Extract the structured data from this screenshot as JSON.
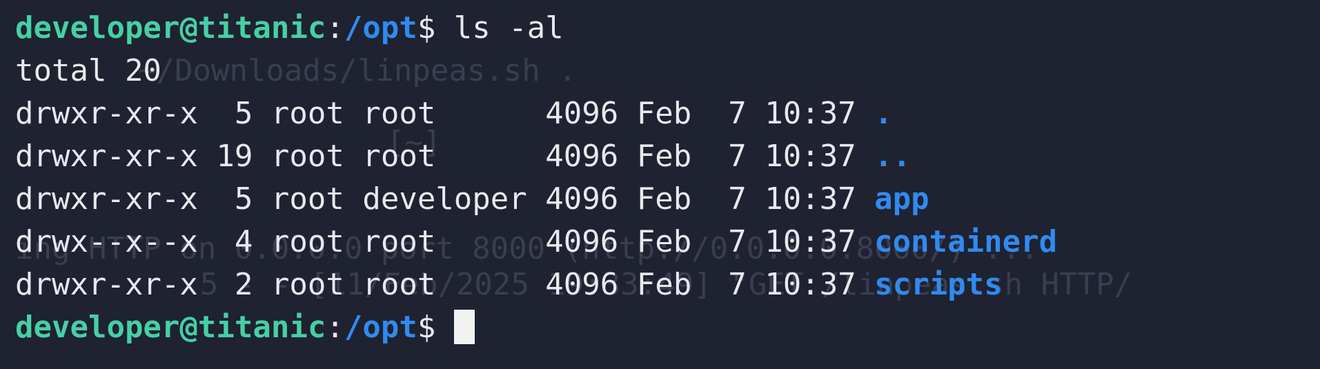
{
  "terminal": {
    "background_color": "#1f2230",
    "prompt": {
      "user_host": "developer@titanic",
      "separator": ":",
      "path": "/opt",
      "symbol": "$ "
    },
    "command": "ls -al",
    "total_line": "total 20",
    "listing": [
      {
        "perms": "drwxr-xr-x",
        "links": " 5",
        "owner": "root",
        "group": "root     ",
        "size": "4096",
        "month": "Feb",
        "day": " 7",
        "time": "10:37",
        "name": "."
      },
      {
        "perms": "drwxr-xr-x",
        "links": "19",
        "owner": "root",
        "group": "root     ",
        "size": "4096",
        "month": "Feb",
        "day": " 7",
        "time": "10:37",
        "name": ".."
      },
      {
        "perms": "drwxr-xr-x",
        "links": " 5",
        "owner": "root",
        "group": "developer",
        "size": "4096",
        "month": "Feb",
        "day": " 7",
        "time": "10:37",
        "name": "app"
      },
      {
        "perms": "drwx--x--x",
        "links": " 4",
        "owner": "root",
        "group": "root     ",
        "size": "4096",
        "month": "Feb",
        "day": " 7",
        "time": "10:37",
        "name": "containerd"
      },
      {
        "perms": "drwxr-xr-x",
        "links": " 2",
        "owner": "root",
        "group": "root     ",
        "size": "4096",
        "month": "Feb",
        "day": " 7",
        "time": "10:37",
        "name": "scripts"
      }
    ],
    "ghost_text": [
      "~/Downloads/linpeas.sh .",
      "[~]",
      "ing HTTP on 0.0.0.0 port 8000 (http://0.0.0.0:8000/) ...",
      "5 - - [11/Feb/2025 19:33:49] \"GET /linpeas.sh HTTP/"
    ]
  }
}
